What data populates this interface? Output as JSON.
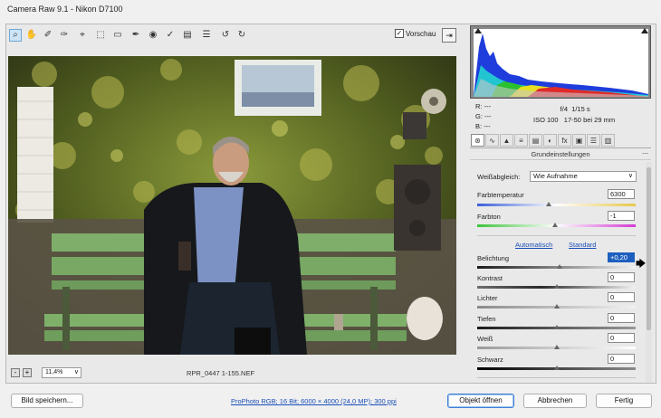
{
  "window": {
    "title": "Camera Raw 9.1 - Nikon D7100"
  },
  "toolbar": {
    "tools": [
      "zoom-icon",
      "hand-icon",
      "white-balance-icon",
      "color-sampler-icon",
      "target-adjust-icon",
      "crop-icon",
      "straighten-icon",
      "spot-removal-icon",
      "red-eye-icon",
      "adjustment-brush-icon",
      "graduated-filter-icon",
      "preferences-icon",
      "rotate-ccw-icon",
      "rotate-cw-icon"
    ],
    "tool_glyphs": [
      "⌕",
      "✋",
      "✐",
      "✑",
      "⌖",
      "⬚",
      "▭",
      "✒",
      "◉",
      "✓",
      "▤",
      "☰",
      "↺",
      "↻"
    ],
    "preview_label": "Vorschau",
    "preview_checked": "✓",
    "fullscreen_glyph": "⇥"
  },
  "bottombar": {
    "zoom_out": "-",
    "zoom_in": "+",
    "zoom_value": "11,4%",
    "zoom_dd": "∨",
    "filename": "RPR_0447 1-155.NEF"
  },
  "info": {
    "r_label": "R:",
    "r_val": "---",
    "g_label": "G:",
    "g_val": "---",
    "b_label": "B:",
    "b_val": "---",
    "aperture": "f/4",
    "shutter": "1/15 s",
    "iso": "ISO 100",
    "lens": "17-50 bei 29 mm"
  },
  "tabs": [
    "⊛",
    "∿",
    "▲",
    "≡",
    "▤",
    "◐",
    "fx",
    "▣",
    "☰",
    "▥"
  ],
  "panel": {
    "heading": "Grundeinstellungen",
    "menu_glyph": "⋯",
    "wb_label": "Weißabgleich:",
    "wb_value": "Wie Aufnahme",
    "wb_dd": "∨",
    "auto_link": "Automatisch",
    "std_link": "Standard",
    "sliders": [
      {
        "label": "Farbtemperatur",
        "value": "6300",
        "pos": 0.45
      },
      {
        "label": "Farbton",
        "value": "-1",
        "pos": 0.49
      },
      {
        "label": "Belichtung",
        "value": "+0,20",
        "pos": 0.52
      },
      {
        "label": "Kontrast",
        "value": "0",
        "pos": 0.5
      },
      {
        "label": "Lichter",
        "value": "0",
        "pos": 0.5
      },
      {
        "label": "Tiefen",
        "value": "0",
        "pos": 0.5
      },
      {
        "label": "Weiß",
        "value": "0",
        "pos": 0.5
      },
      {
        "label": "Schwarz",
        "value": "0",
        "pos": 0.5
      }
    ]
  },
  "footer": {
    "save": "Bild speichern...",
    "workflow": "ProPhoto RGB; 16 Bit; 6000 × 4000 (24,0 MP); 300 ppi",
    "open": "Objekt öffnen",
    "cancel": "Abbrechen",
    "done": "Fertig"
  },
  "colors": {
    "accent": "#1d5fbf",
    "link": "#1a4fb8",
    "selected_value_bg": "#1d5fbf"
  }
}
